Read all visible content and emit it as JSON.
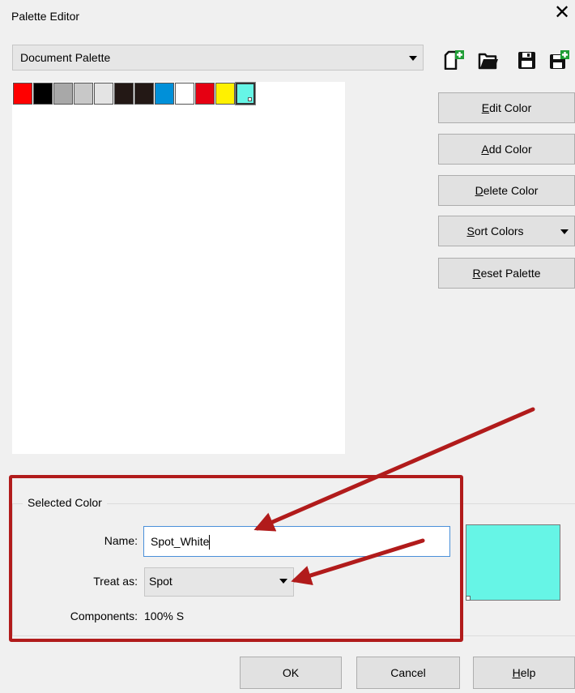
{
  "window": {
    "title": "Palette Editor",
    "close_glyph": "✕"
  },
  "palette_select": {
    "value": "Document Palette"
  },
  "toolbar_icons": [
    "new-palette-icon",
    "open-palette-icon",
    "save-palette-icon",
    "save-as-palette-icon"
  ],
  "swatches": [
    "#ff0000",
    "#000000",
    "#a8a8a8",
    "#c8c8c8",
    "#e4e4e4",
    "#231815",
    "#231815",
    "#0090d9",
    "#ffffff",
    "#e60012",
    "#fff100",
    "#66f5e6"
  ],
  "selected_swatch_index": 11,
  "buttons": {
    "edit_color": {
      "mnemonic": "E",
      "rest": "dit Color"
    },
    "add_color": {
      "mnemonic": "A",
      "rest": "dd Color"
    },
    "delete_color": {
      "mnemonic": "D",
      "rest": "elete Color"
    },
    "sort_colors": {
      "mnemonic": "S",
      "rest": "ort Colors"
    },
    "reset_palette": {
      "mnemonic": "R",
      "rest": "eset Palette"
    }
  },
  "selected_color": {
    "group_label": "Selected Color",
    "name_label": "Name:",
    "name_value": "Spot_White",
    "treat_label": "Treat as:",
    "treat_value": "Spot",
    "components_label": "Components:",
    "components_value": "100% S",
    "preview_color": "#66f5e6"
  },
  "dialog_buttons": {
    "ok": "OK",
    "cancel": "Cancel",
    "help": {
      "mnemonic": "H",
      "rest": "elp"
    }
  },
  "annotation": {
    "color": "#b11b1b"
  }
}
